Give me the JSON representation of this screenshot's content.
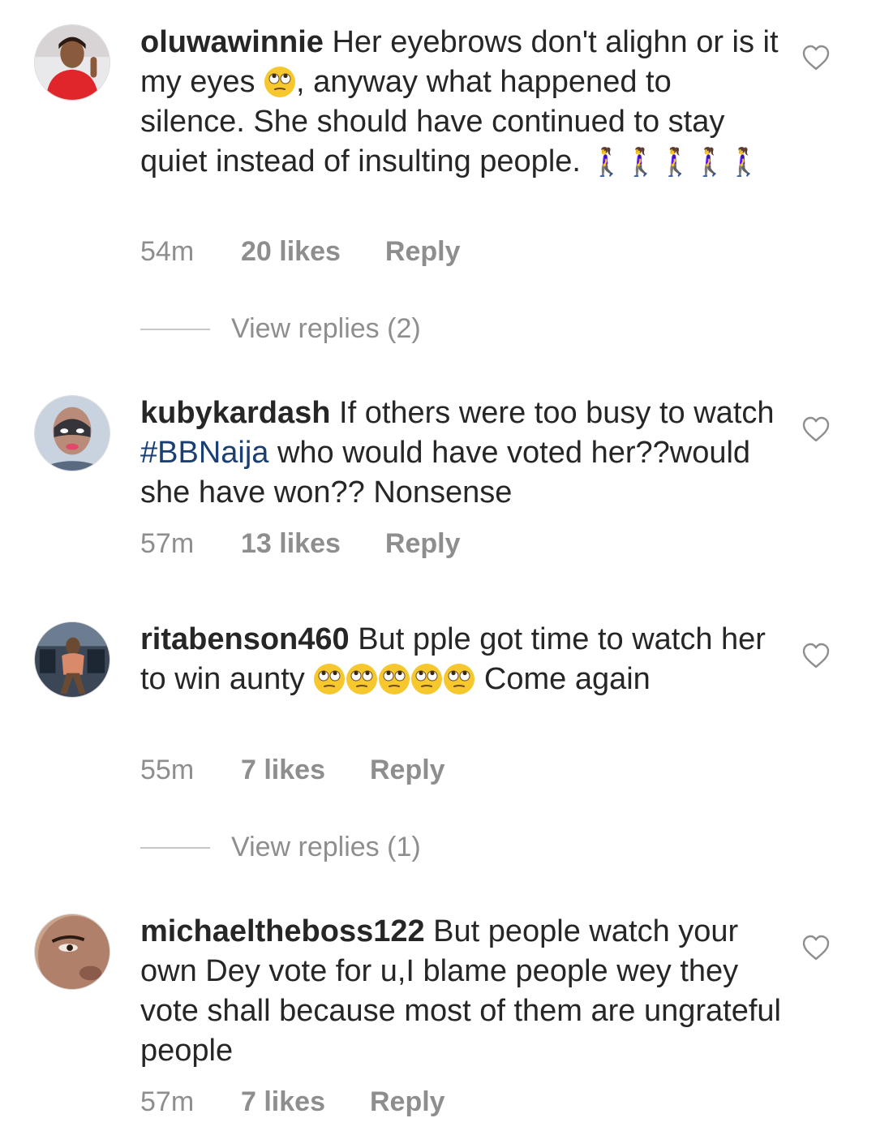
{
  "comments": [
    {
      "username": "oluwawinnie",
      "text_parts": [
        "Her eyebrows don't alighn or is it my eyes ",
        ", anyway what happened to silence. She should have continued to stay quiet instead of insulting people. "
      ],
      "walk_emoji": "🚶‍♀️🚶‍♀️🚶‍♀️🚶‍♀️🚶‍♀️",
      "time": "54m",
      "likes": "20 likes",
      "reply": "Reply",
      "view_replies": "View replies (2)"
    },
    {
      "username": "kubykardash",
      "text_before": "If others were too busy to watch ",
      "hashtag": "#BBNaija",
      "text_after": " who would have voted her??would she have won?? Nonsense",
      "time": "57m",
      "likes": "13 likes",
      "reply": "Reply"
    },
    {
      "username": "ritabenson460",
      "text_before": "But pple got time to watch her to win aunty ",
      "text_after": " Come again",
      "time": "55m",
      "likes": "7 likes",
      "reply": "Reply",
      "view_replies": "View replies (1)"
    },
    {
      "username": "michaeltheboss122",
      "text": "But people watch your own Dey vote for u,I blame people wey they vote shall because most of them are ungrateful people",
      "time": "57m",
      "likes": "7 likes",
      "reply": "Reply"
    }
  ],
  "icons": {
    "heart": "heart-outline-icon",
    "roll_eyes": "face-with-rolling-eyes-emoji",
    "walk": "woman-walking-emoji"
  },
  "colors": {
    "text": "#262626",
    "meta": "#8e8e8e",
    "hashtag": "#1b3f72",
    "emoji": "#f7c72e"
  }
}
